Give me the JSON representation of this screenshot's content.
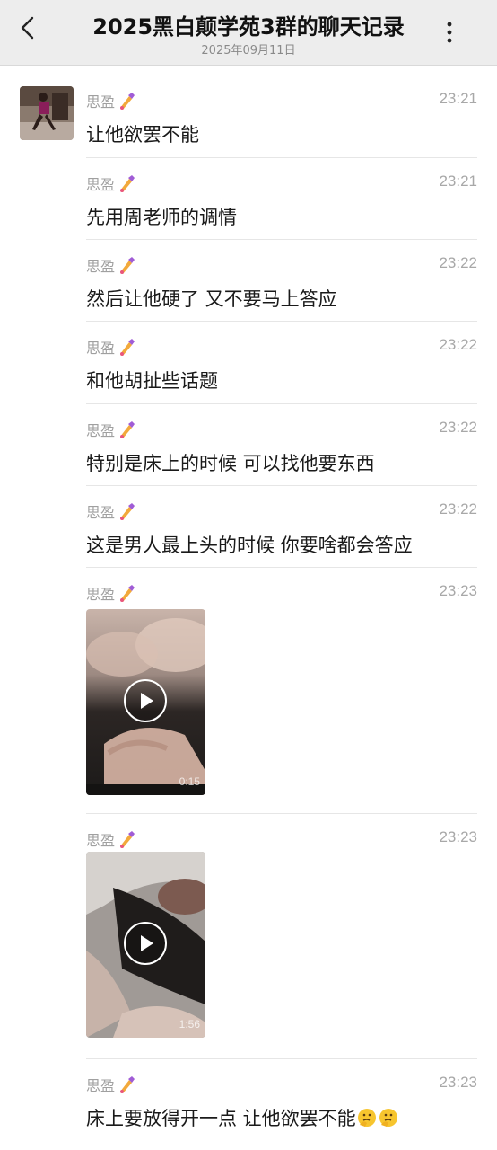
{
  "header": {
    "title": "2025黑白颠学苑3群的聊天记录",
    "date": "2025年09月11日",
    "back_icon": "chevron-left-icon",
    "more_icon": "vertical-dots-icon"
  },
  "messages": [
    {
      "sender": "思盈",
      "time": "23:21",
      "text": "让他欲罢不能"
    },
    {
      "sender": "思盈",
      "time": "23:21",
      "text": "先用周老师的调情"
    },
    {
      "sender": "思盈",
      "time": "23:22",
      "text": "然后让他硬了 又不要马上答应"
    },
    {
      "sender": "思盈",
      "time": "23:22",
      "text": "和他胡扯些话题"
    },
    {
      "sender": "思盈",
      "time": "23:22",
      "text": "特别是床上的时候 可以找他要东西"
    },
    {
      "sender": "思盈",
      "time": "23:22",
      "text": "这是男人最上头的时候 你要啥都会答应"
    },
    {
      "sender": "思盈",
      "time": "23:23",
      "video_duration": "0:15"
    },
    {
      "sender": "思盈",
      "time": "23:23",
      "video_duration": "1:56"
    },
    {
      "sender": "思盈",
      "time": "23:23",
      "text": "床上要放得开一点 让他欲罢不能"
    }
  ],
  "icons": {
    "sender_emoji": "nail-polish-icon",
    "thinking_emoji": "thinking-face-icon",
    "play": "play-icon"
  },
  "colors": {
    "header_bg": "#ededed",
    "sender": "#a0a0a0",
    "time": "#a8a8a8",
    "text": "#1a1a1a"
  }
}
